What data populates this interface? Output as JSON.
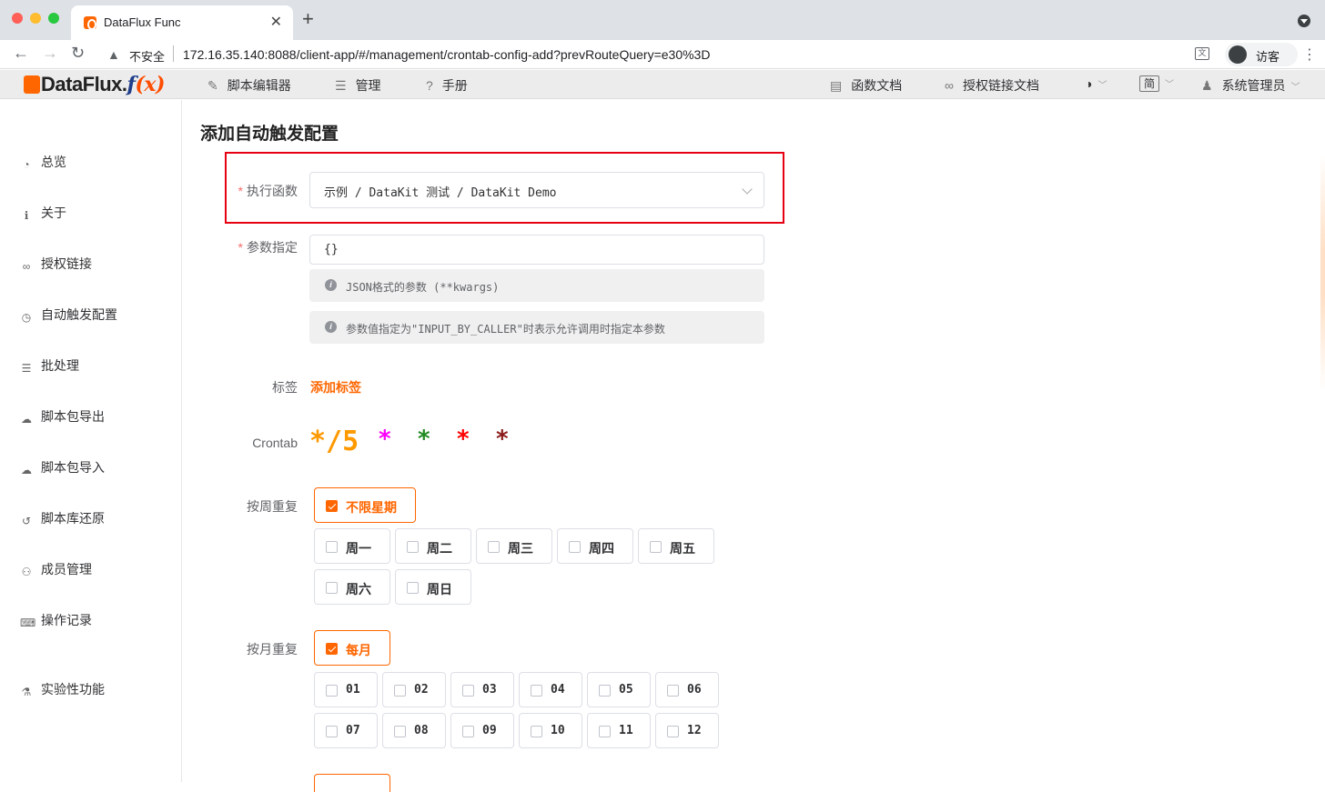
{
  "browser": {
    "tab_title": "DataFlux Func",
    "tab_close": "✕",
    "new_tab": "+",
    "insecure_label": "不安全",
    "url": "172.16.35.140:8088/client-app/#/management/crontab-config-add?prevRouteQuery=e30%3D",
    "profile_label": "访客",
    "back": "←",
    "forward": "→",
    "reload": "↻",
    "warn": "▲",
    "kebab": "⋮",
    "translate": "文"
  },
  "header": {
    "logo_main": "DataFlux.",
    "logo_f": "f",
    "logo_x": "(x)",
    "menu": [
      "脚本编辑器",
      "管理",
      "手册"
    ],
    "right_menu": [
      "函数文档",
      "授权链接文档"
    ],
    "lang": "简",
    "user": "系统管理员",
    "theme_glyph": "◑",
    "caret": "﹀"
  },
  "sidebar": {
    "items": [
      {
        "label": "总览",
        "icon": "dashboard-icon",
        "glyph": "◔"
      },
      {
        "label": "关于",
        "icon": "info-icon",
        "glyph": "ℹ"
      },
      {
        "label": "授权链接",
        "icon": "link-icon",
        "glyph": "∞"
      },
      {
        "label": "自动触发配置",
        "icon": "clock-icon",
        "glyph": "◷"
      },
      {
        "label": "批处理",
        "icon": "server-icon",
        "glyph": "☰"
      },
      {
        "label": "脚本包导出",
        "icon": "cloud-download-icon",
        "glyph": "☁"
      },
      {
        "label": "脚本包导入",
        "icon": "cloud-upload-icon",
        "glyph": "☁"
      },
      {
        "label": "脚本库还原",
        "icon": "history-icon",
        "glyph": "↺"
      },
      {
        "label": "成员管理",
        "icon": "users-icon",
        "glyph": "⚇"
      },
      {
        "label": "操作记录",
        "icon": "keyboard-icon",
        "glyph": "⌨"
      },
      {
        "label": "实验性功能",
        "icon": "flask-icon",
        "glyph": "⚗"
      }
    ]
  },
  "form": {
    "title": "添加自动触发配置",
    "func_label": "执行函数",
    "func_value": "示例 / DataKit 测试 / DataKit Demo",
    "args_label": "参数指定",
    "args_value": "{}",
    "hint1": "JSON格式的参数 (**kwargs)",
    "hint2": "参数值指定为\"INPUT_BY_CALLER\"时表示允许调用时指定本参数",
    "tags_label": "标签",
    "add_tag": "添加标签",
    "crontab_label": "Crontab",
    "crontab": [
      {
        "text": "*/5",
        "color": "#ff9900"
      },
      {
        "text": "*",
        "color": "#ff00ff"
      },
      {
        "text": "*",
        "color": "#228b22"
      },
      {
        "text": "*",
        "color": "#ff0000"
      },
      {
        "text": "*",
        "color": "#8b1a1a"
      }
    ],
    "weekly_label": "按周重复",
    "weekly_all": "不限星期",
    "weekdays": [
      "周一",
      "周二",
      "周三",
      "周四",
      "周五",
      "周六",
      "周日"
    ],
    "monthly_label": "按月重复",
    "monthly_all": "每月",
    "months": [
      "01",
      "02",
      "03",
      "04",
      "05",
      "06",
      "07",
      "08",
      "09",
      "10",
      "11",
      "12"
    ]
  }
}
